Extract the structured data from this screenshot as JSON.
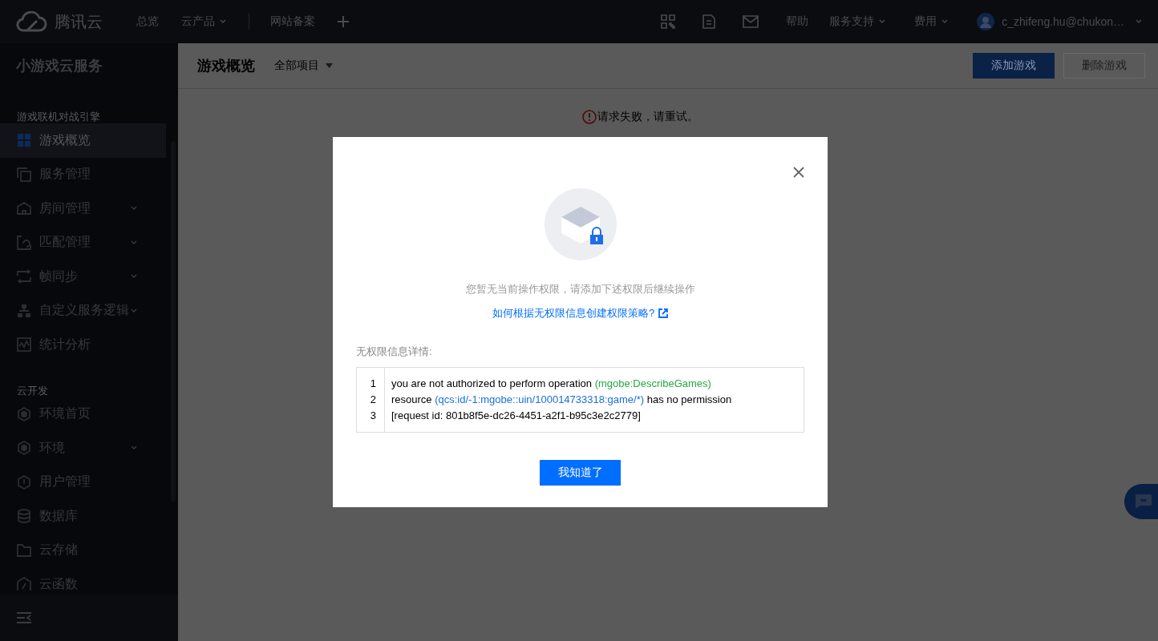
{
  "topbar": {
    "logo_text": "腾讯云",
    "nav": [
      {
        "label": "总览",
        "has_dropdown": false
      },
      {
        "label": "云产品",
        "has_dropdown": true
      },
      {
        "label": "网站备案",
        "has_dropdown": false
      }
    ],
    "help": "帮助",
    "menus": [
      {
        "label": "服务支持"
      },
      {
        "label": "费用"
      }
    ],
    "account": "c_zhifeng.hu@chukon…"
  },
  "sidebar": {
    "title": "小游戏云服务",
    "groups": [
      {
        "title": "游戏联机对战引擎",
        "items": [
          {
            "label": "游戏概览",
            "selected": true,
            "has_submenu": false
          },
          {
            "label": "服务管理",
            "selected": false,
            "has_submenu": false
          },
          {
            "label": "房间管理",
            "selected": false,
            "has_submenu": true
          },
          {
            "label": "匹配管理",
            "selected": false,
            "has_submenu": true
          },
          {
            "label": "帧同步",
            "selected": false,
            "has_submenu": true
          },
          {
            "label": "自定义服务逻辑",
            "selected": false,
            "has_submenu": true
          },
          {
            "label": "统计分析",
            "selected": false,
            "has_submenu": false
          }
        ]
      },
      {
        "title": "云开发",
        "items": [
          {
            "label": "环境首页",
            "selected": false,
            "has_submenu": false
          },
          {
            "label": "环境",
            "selected": false,
            "has_submenu": true
          },
          {
            "label": "用户管理",
            "selected": false,
            "has_submenu": false
          },
          {
            "label": "数据库",
            "selected": false,
            "has_submenu": false
          },
          {
            "label": "云存储",
            "selected": false,
            "has_submenu": false
          },
          {
            "label": "云函数",
            "selected": false,
            "has_submenu": false
          }
        ]
      }
    ]
  },
  "header": {
    "title": "游戏概览",
    "project_filter": "全部项目",
    "buttons": [
      {
        "label": "添加游戏",
        "kind": "primary",
        "disabled": false
      },
      {
        "label": "删除游戏",
        "kind": "default",
        "disabled": true
      }
    ]
  },
  "error_message": "请求失败，请重试。",
  "dialog": {
    "message": "您暂无当前操作权限，请添加下述权限后继续操作",
    "help_link": "如何根据无权限信息创建权限策略?",
    "details_label": "无权限信息详情:",
    "details_lines": [
      {
        "number": "1",
        "segments": [
          {
            "text": "you are not authorized to perform operation",
            "kind": "plain"
          },
          {
            "text": "(mgobe:DescribeGames)",
            "kind": "operation"
          }
        ]
      },
      {
        "number": "2",
        "segments": [
          {
            "text": "resource",
            "kind": "plain"
          },
          {
            "text": "(qcs:id/-1:mgobe::uin/100014733318:game/*)",
            "kind": "resource"
          },
          {
            "text": "has no permission",
            "kind": "plain"
          }
        ]
      },
      {
        "number": "3",
        "segments": [
          {
            "text": "[request id: 801b8f5e-dc26-4451-a2f1-b95c3e2c2779]",
            "kind": "plain"
          }
        ]
      }
    ],
    "confirm_button": "我知道了"
  }
}
